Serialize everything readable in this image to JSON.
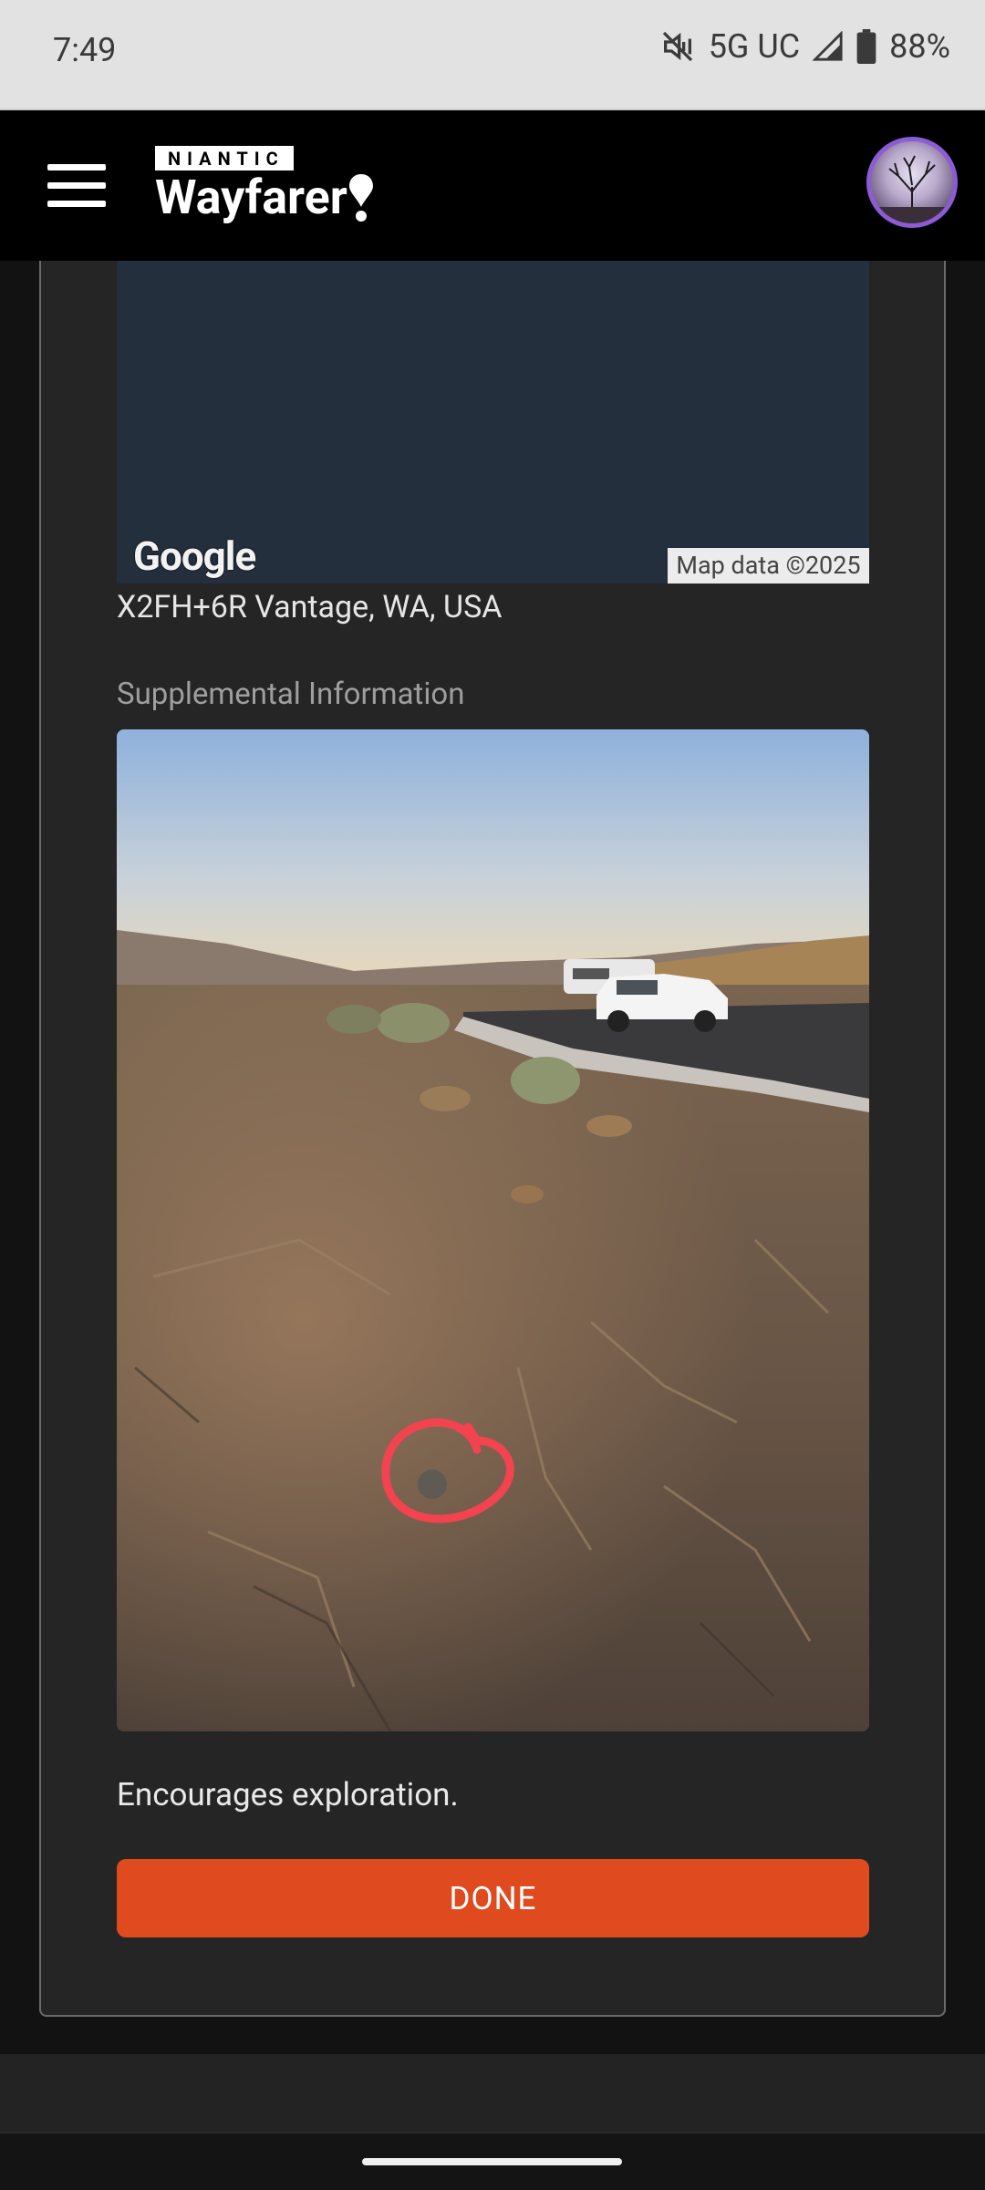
{
  "status_bar": {
    "time": "7:49",
    "network": "5G UC",
    "battery": "88%",
    "icons": [
      "mute-icon",
      "signal-icon",
      "battery-icon"
    ]
  },
  "header": {
    "brand_small": "NIANTIC",
    "brand_large": "Wayfarer",
    "menu_icon": "hamburger-icon",
    "pin_icon": "location-pin-icon",
    "avatar": "profile-avatar"
  },
  "map": {
    "attribution_logo": "Google",
    "copyright": "Map data ©2025"
  },
  "address": "X2FH+6R Vantage, WA, USA",
  "supplemental": {
    "label": "Supplemental Information",
    "photo": "supplemental-photo"
  },
  "description": "Encourages exploration.",
  "actions": {
    "done_label": "DONE",
    "accent_color": "#e04a1f"
  }
}
